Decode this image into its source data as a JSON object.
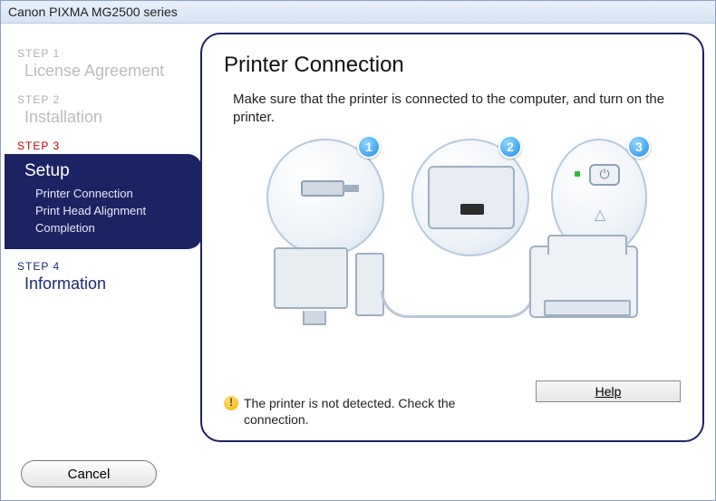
{
  "window": {
    "title": "Canon PIXMA MG2500 series"
  },
  "sidebar": {
    "steps": [
      {
        "tag": "STEP 1",
        "title": "License Agreement"
      },
      {
        "tag": "STEP 2",
        "title": "Installation"
      },
      {
        "tag": "STEP 3",
        "title": "Setup",
        "subitems": [
          "Printer Connection",
          "Print Head Alignment",
          "Completion"
        ]
      },
      {
        "tag": "STEP 4",
        "title": "Information"
      }
    ]
  },
  "content": {
    "heading": "Printer Connection",
    "instruction": "Make sure that the printer is connected to the computer, and turn on the printer.",
    "badges": [
      "1",
      "2",
      "3"
    ],
    "status": "The printer is not detected. Check the connection.",
    "help_label": "Help"
  },
  "footer": {
    "cancel_label": "Cancel"
  }
}
